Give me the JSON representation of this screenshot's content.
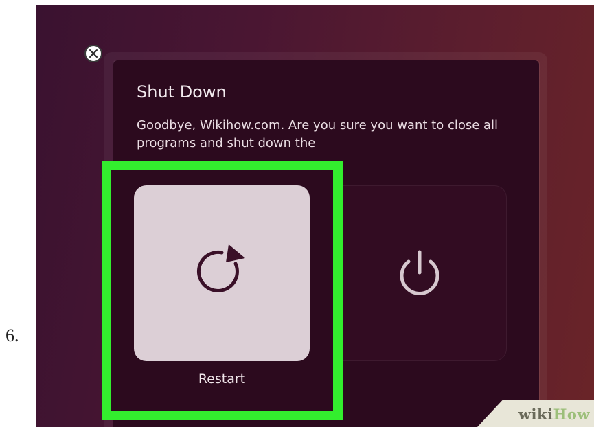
{
  "step": {
    "number": "6."
  },
  "dialog": {
    "title": "Shut Down",
    "message": "Goodbye, Wikihow.com. Are you sure you want to close all programs and shut down the"
  },
  "buttons": {
    "restart": {
      "label": "Restart",
      "icon": "restart-icon"
    },
    "power_off": {
      "icon": "power-icon"
    },
    "close": {
      "icon": "close-icon"
    }
  },
  "watermark": {
    "part1": "wiki",
    "part2": "How"
  },
  "colors": {
    "highlight": "#33ee2e",
    "dialog_bg": "#2c0a1e",
    "restart_tile": "#dccfd6"
  }
}
